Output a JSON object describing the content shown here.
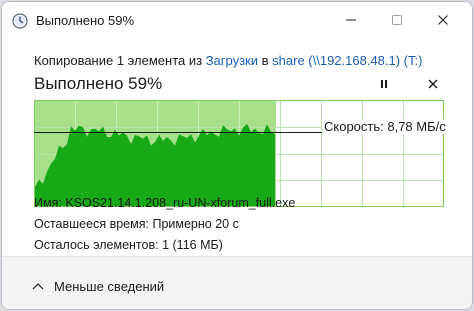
{
  "window": {
    "title": "Выполнено 59%",
    "icon": "clock-icon"
  },
  "copy": {
    "prefix": "Копирование 1 элемента из ",
    "source": "Загрузки",
    "middle": " в ",
    "destination": "share (\\\\192.168.48.1) (T:)"
  },
  "progress": {
    "title": "Выполнено 59%",
    "percent": 59,
    "speed_label": "Скорость: 8,78 МБ/с",
    "speed_line_fraction": 0.3
  },
  "details": {
    "name_label": "Имя:",
    "name_value": "KSOS21.14.1.208_ru-UN-xforum_full.exe",
    "time_label": "Оставшееся время:",
    "time_value": "Примерно 20 с",
    "items_label": "Осталось элементов:",
    "items_value": "1 (116 МБ)"
  },
  "footer": {
    "less_details_label": "Меньше сведений"
  },
  "colors": {
    "graph_fill": "#a6e08a",
    "graph_curve": "#17a917",
    "graph_grid": "#b8e2a8",
    "link": "#1a5fb4"
  }
}
